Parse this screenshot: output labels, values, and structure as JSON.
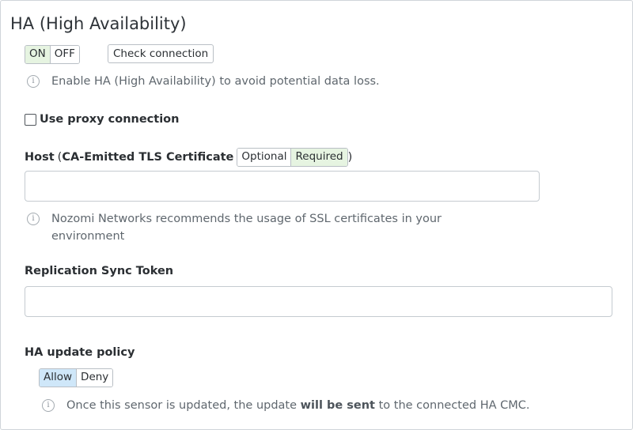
{
  "page": {
    "title": "HA (High Availability)"
  },
  "ha_toggle": {
    "on_label": "ON",
    "off_label": "OFF",
    "selected": "ON"
  },
  "check_connection": {
    "label": "Check connection"
  },
  "ha_hint": {
    "text": "Enable HA (High Availability) to avoid potential data loss."
  },
  "proxy": {
    "label": "Use proxy connection",
    "checked": false
  },
  "host": {
    "label_prefix": "Host",
    "open_paren": "(",
    "cert_label": "CA-Emitted TLS Certificate",
    "close_paren": ")",
    "optional_label": "Optional",
    "required_label": "Required",
    "selected": "Required",
    "value": "",
    "hint": "Nozomi Networks recommends the usage of SSL certificates in your environment"
  },
  "replication": {
    "label": "Replication Sync Token",
    "value": ""
  },
  "update_policy": {
    "label": "HA update policy",
    "allow_label": "Allow",
    "deny_label": "Deny",
    "selected": "Allow",
    "hint_prefix": "Once this sensor is updated, the update ",
    "hint_bold": "will be sent",
    "hint_suffix": " to the connected HA CMC."
  },
  "colors": {
    "selected_green": "#e6f4e1",
    "selected_blue": "#cfe7f9",
    "border": "#b9bfc5",
    "hint_text": "#5f676e"
  },
  "icons": {
    "info": "info-circle-icon"
  }
}
